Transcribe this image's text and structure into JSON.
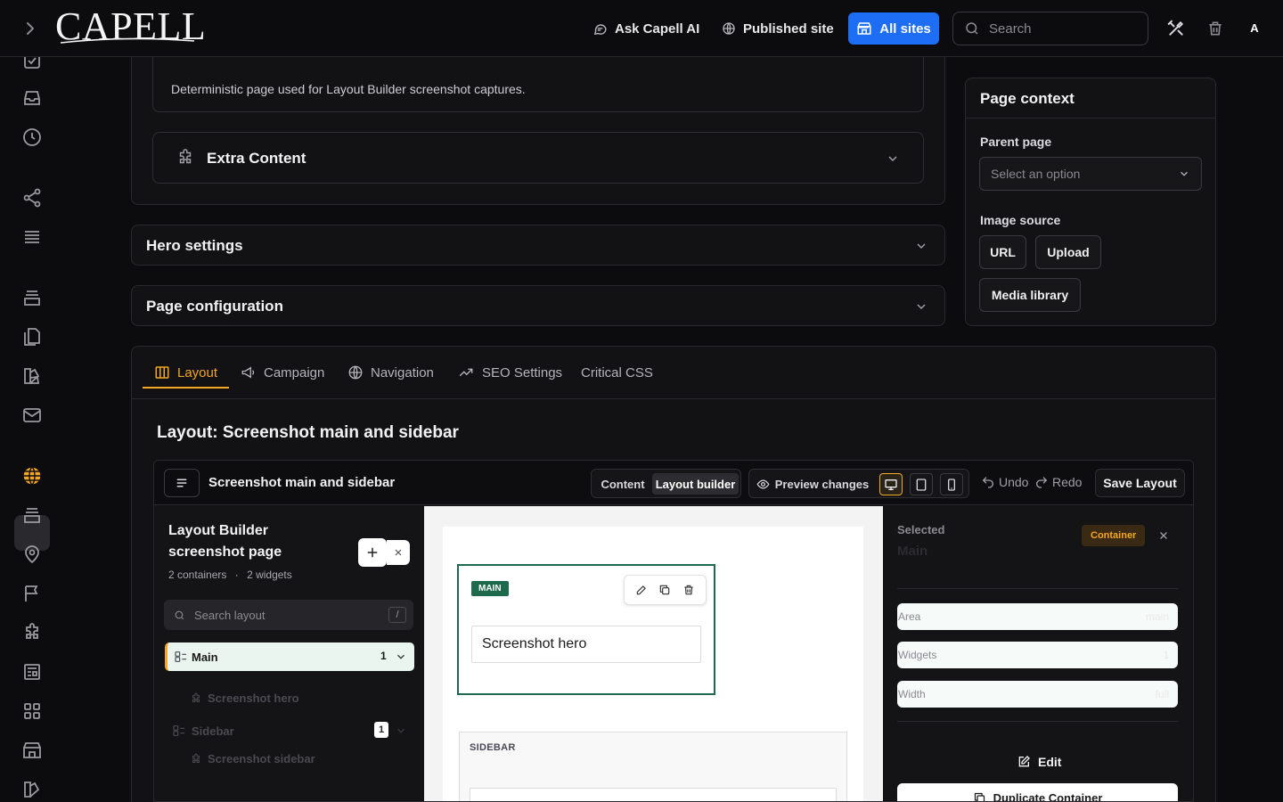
{
  "topbar": {
    "logo": "CAPELL",
    "ask_ai": "Ask Capell AI",
    "published_site": "Published site",
    "all_sites": "All sites",
    "search_placeholder": "Search",
    "avatar": "A"
  },
  "form": {
    "description": "Deterministic page used for Layout Builder screenshot captures.",
    "extra_content": "Extra Content",
    "hero_settings": "Hero settings",
    "page_configuration": "Page configuration"
  },
  "page_context": {
    "title": "Page context",
    "parent_page_label": "Parent page",
    "parent_page_placeholder": "Select an option",
    "image_source_label": "Image source",
    "url_button": "URL",
    "upload_button": "Upload",
    "media_library_button": "Media library"
  },
  "tabs": [
    {
      "label": "Layout",
      "active": true
    },
    {
      "label": "Campaign"
    },
    {
      "label": "Navigation"
    },
    {
      "label": "SEO Settings"
    },
    {
      "label": "Critical CSS"
    }
  ],
  "layout_heading": "Layout: Screenshot main and sidebar",
  "builder": {
    "title": "Screenshot main and sidebar",
    "mode_content": "Content",
    "mode_layout_builder": "Layout builder",
    "preview_changes": "Preview changes",
    "undo": "Undo",
    "redo": "Redo",
    "save_layout": "Save Layout",
    "left_panel": {
      "title": "Layout Builder screenshot page",
      "containers": "2 containers",
      "separator": "·",
      "widgets": "2 widgets",
      "search_placeholder": "Search layout",
      "search_shortcut": "/",
      "tree": [
        {
          "label": "Main",
          "count": "1",
          "children": [
            "Screenshot hero"
          ]
        },
        {
          "label": "Sidebar",
          "count": "1",
          "children": [
            "Screenshot sidebar"
          ]
        }
      ]
    },
    "canvas": {
      "main_tag": "MAIN",
      "hero_widget": "Screenshot hero",
      "sidebar_tag": "SIDEBAR"
    },
    "right_panel": {
      "selected_label": "Selected",
      "selected_name": "Main",
      "badge": "Container",
      "area_label": "Area",
      "area_value": "main",
      "widgets_label": "Widgets",
      "widgets_value": "1",
      "width_label": "Width",
      "width_value": "full",
      "edit": "Edit",
      "duplicate": "Duplicate Container"
    }
  },
  "colors": {
    "accent": "#f5a623",
    "primary_blue": "#1e6ef5",
    "main_green": "#1e6a4f",
    "background": "#0c0c0e"
  }
}
